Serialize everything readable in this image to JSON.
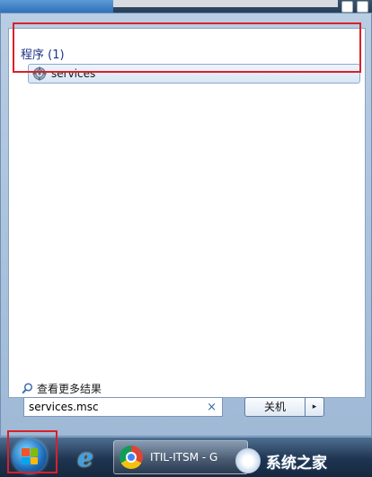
{
  "start_menu": {
    "section_header": "程序 (1)",
    "result_item": {
      "label": "services",
      "icon": "gear-icon"
    },
    "more_results": "查看更多结果"
  },
  "search": {
    "value": "services.msc",
    "clear_glyph": "×"
  },
  "shutdown": {
    "label": "关机",
    "arrow_glyph": "▸"
  },
  "taskbar": {
    "chrome_task_label": "ITIL-ITSM - G",
    "watermark": "系统之家"
  },
  "colors": {
    "highlight": "#d9202a",
    "header_text": "#1e3287"
  }
}
